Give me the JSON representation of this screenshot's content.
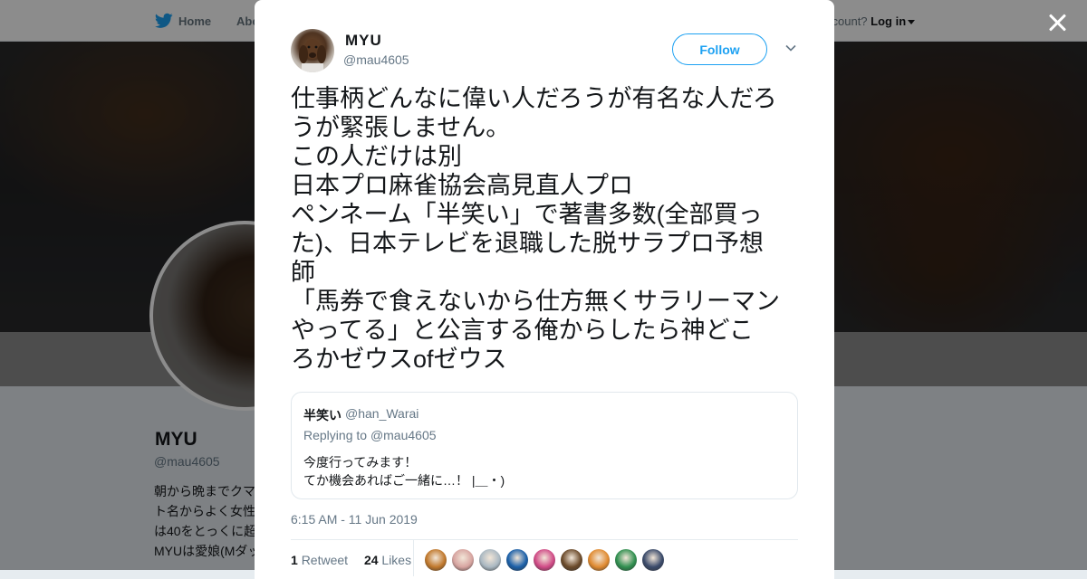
{
  "nav": {
    "home_label": "Home",
    "about_label": "Abo",
    "account_prompt": "ccount?",
    "login_label": "Log in"
  },
  "profile": {
    "name": "MYU",
    "handle": "@mau4605",
    "bio_lines": [
      "朝から晩までクマ",
      "ト名からよく女性",
      "は40をとっくに超",
      "MYUは愛娘(Mダッ"
    ]
  },
  "tweet": {
    "author_name": "MYU",
    "author_handle": "@mau4605",
    "follow_label": "Follow",
    "lines": [
      "仕事柄どんなに偉い人だろうが有名な人だろ",
      "うが緊張しません。",
      "この人だけは別",
      "日本プロ麻雀協会高見直人プロ",
      "ペンネーム「半笑い」で著書多数(全部買っ",
      "た)、日本テレビを退職した脱サラプロ予想",
      "師",
      "「馬券で食えないから仕方無くサラリーマン",
      "やってる」と公言する俺からしたら神どこ",
      "ろかゼウスofゼウス"
    ],
    "timestamp": "6:15 AM - 11 Jun 2019",
    "retweets": "1",
    "retweets_label": "Retweet",
    "likes": "24",
    "likes_label": "Likes"
  },
  "quoted": {
    "name": "半笑い",
    "handle": "@han_Warai",
    "replying_prefix": "Replying to",
    "replying_to": "@mau4605",
    "body_lines": [
      "今度行ってみます！",
      "てか機会あればご一緒に…！ |＿・)"
    ]
  },
  "likers": [
    {
      "icon": "liker-avatar-1",
      "color": "#c0782c"
    },
    {
      "icon": "liker-avatar-2",
      "color": "#d7a4a0"
    },
    {
      "icon": "liker-avatar-3",
      "color": "#aab8c2"
    },
    {
      "icon": "liker-avatar-4",
      "color": "#1a5fa8"
    },
    {
      "icon": "liker-avatar-5",
      "color": "#d04a86"
    },
    {
      "icon": "liker-avatar-6",
      "color": "#6b4a2a"
    },
    {
      "icon": "liker-avatar-7",
      "color": "#e08a30"
    },
    {
      "icon": "liker-avatar-8",
      "color": "#2f8f4f"
    },
    {
      "icon": "liker-avatar-9",
      "color": "#3a4a6a"
    }
  ],
  "colors": {
    "accent": "#1da1f2",
    "secondary_text": "#657786",
    "primary_text": "#14171a"
  }
}
